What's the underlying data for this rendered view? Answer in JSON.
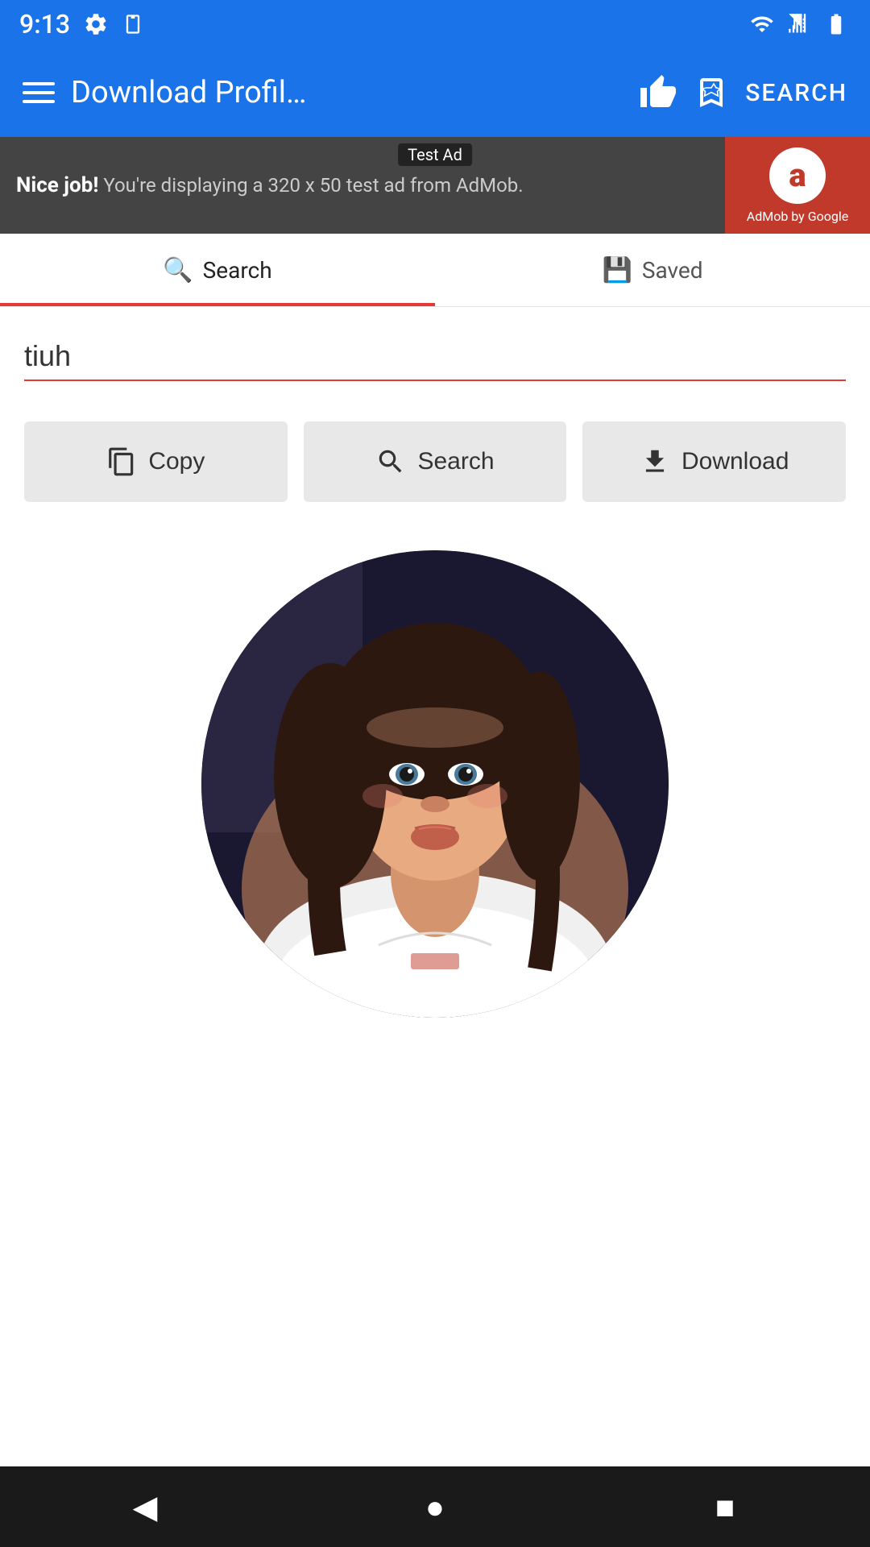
{
  "statusBar": {
    "time": "9:13",
    "icons": {
      "settings": "⚙",
      "sim": "📋",
      "wifi": "wifi",
      "signal": "signal",
      "battery": "battery"
    }
  },
  "appBar": {
    "title": "Download Profil…",
    "likeIcon": "👍",
    "bookmarkIcon": "🔖",
    "searchLabel": "SEARCH"
  },
  "adBanner": {
    "label": "Test Ad",
    "text1": "Nice job!",
    "text2": " You're displaying a 320 x 50 test ad from AdMob.",
    "logoText": "AdMob by Google",
    "logoLetter": "a"
  },
  "tabs": [
    {
      "id": "search",
      "label": "Search",
      "icon": "🔍",
      "active": true
    },
    {
      "id": "saved",
      "label": "Saved",
      "icon": "💾",
      "active": false
    }
  ],
  "searchInput": {
    "value": "tiuh",
    "placeholder": ""
  },
  "buttons": {
    "copy": {
      "label": "Copy",
      "icon": "copy"
    },
    "search": {
      "label": "Search",
      "icon": "search"
    },
    "download": {
      "label": "Download",
      "icon": "download"
    }
  },
  "navBar": {
    "back": "◀",
    "home": "●",
    "recent": "■"
  }
}
